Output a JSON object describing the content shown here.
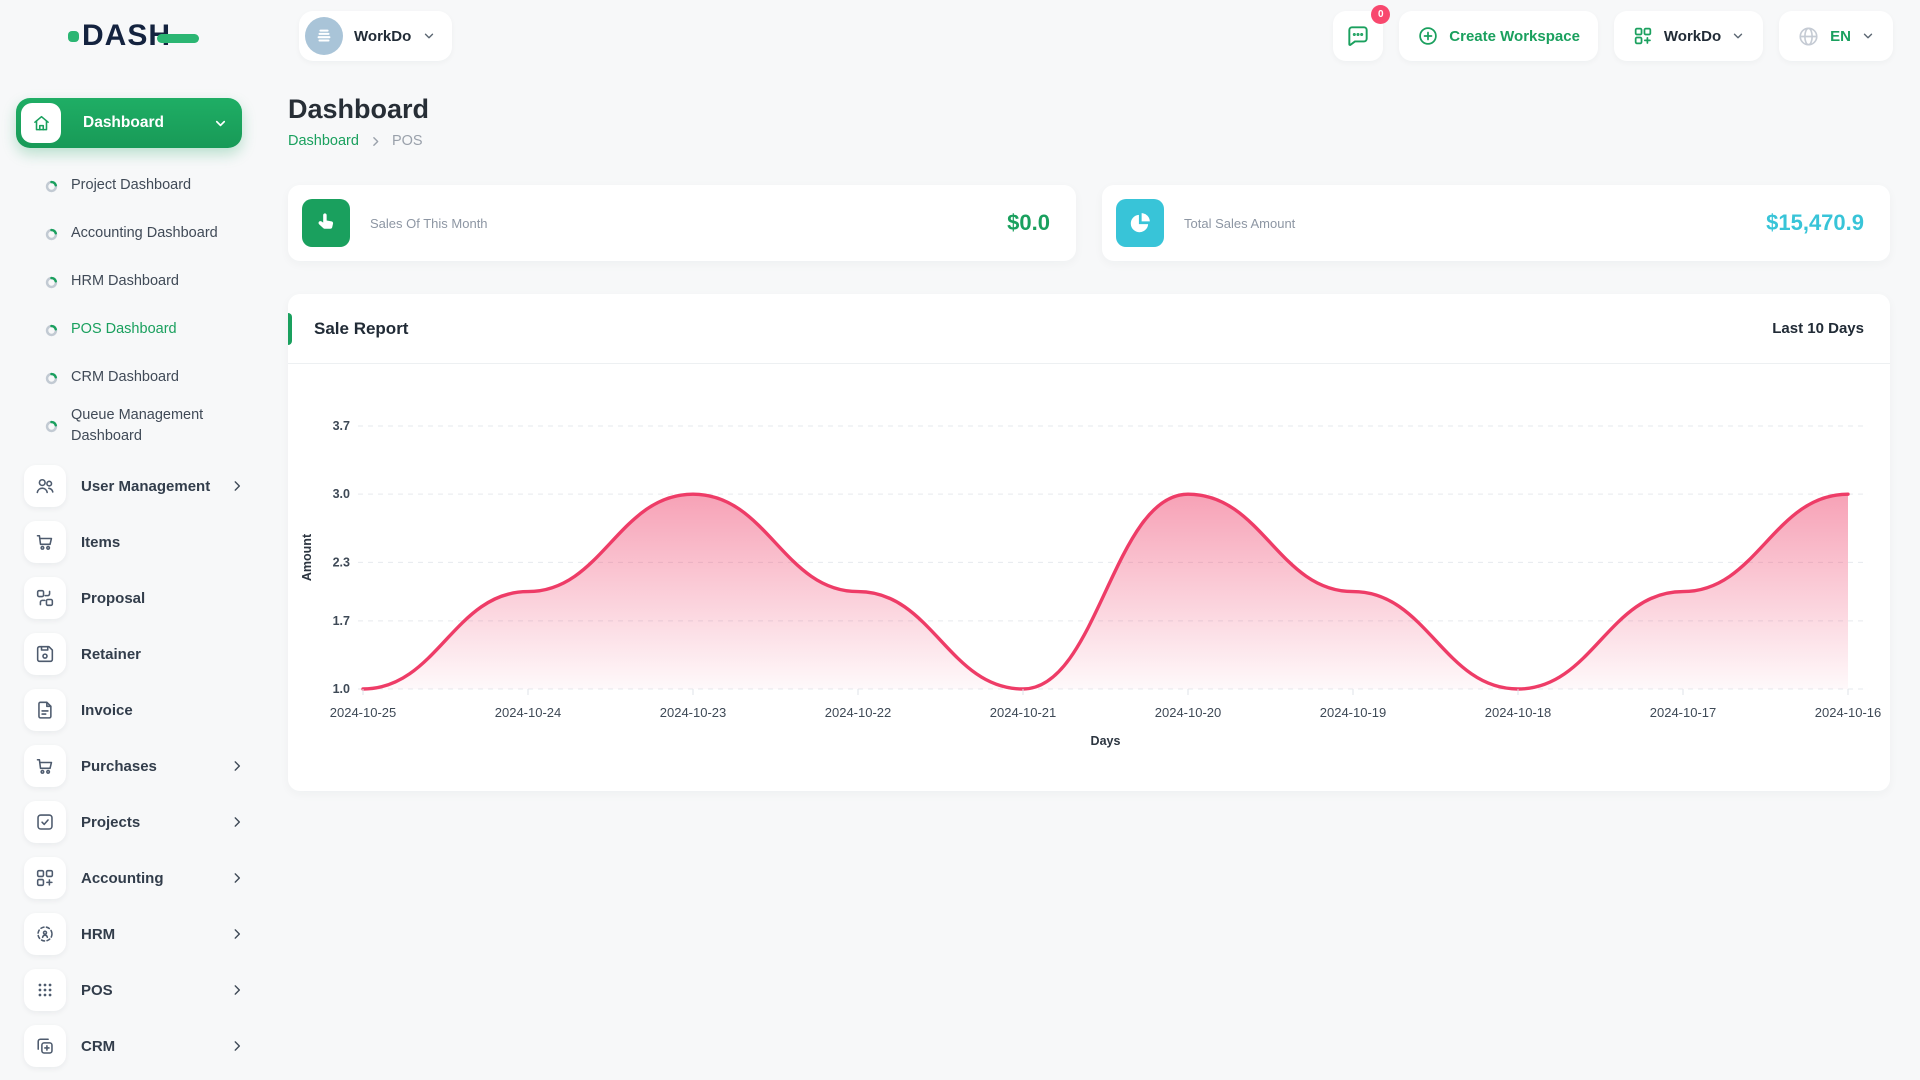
{
  "brand": {
    "logo_text": "DASH"
  },
  "header": {
    "workspace_name": "WorkDo",
    "messages_badge": "0",
    "create_workspace_label": "Create Workspace",
    "apps_menu_label": "WorkDo",
    "language_label": "EN"
  },
  "page": {
    "title": "Dashboard",
    "breadcrumb_root": "Dashboard",
    "breadcrumb_current": "POS"
  },
  "sidebar": {
    "active_label": "Dashboard",
    "dashboard_children": [
      "Project Dashboard",
      "Accounting Dashboard",
      "HRM Dashboard",
      "POS Dashboard",
      "CRM Dashboard",
      "Queue Management Dashboard"
    ],
    "active_child": "POS Dashboard",
    "items": [
      {
        "label": "User Management",
        "icon": "users-icon",
        "chevron": true
      },
      {
        "label": "Items",
        "icon": "cart-icon",
        "chevron": false
      },
      {
        "label": "Proposal",
        "icon": "route-squares-icon",
        "chevron": false
      },
      {
        "label": "Retainer",
        "icon": "save-icon",
        "chevron": false
      },
      {
        "label": "Invoice",
        "icon": "file-icon",
        "chevron": false
      },
      {
        "label": "Purchases",
        "icon": "cart-icon",
        "chevron": true
      },
      {
        "label": "Projects",
        "icon": "check-square-icon",
        "chevron": true
      },
      {
        "label": "Accounting",
        "icon": "grid-plus-icon",
        "chevron": true
      },
      {
        "label": "HRM",
        "icon": "focus-person-icon",
        "chevron": true
      },
      {
        "label": "POS",
        "icon": "dots-grid-icon",
        "chevron": true
      },
      {
        "label": "CRM",
        "icon": "copy-plus-icon",
        "chevron": true
      }
    ]
  },
  "cards": [
    {
      "label": "Sales Of This Month",
      "value": "$0.0",
      "icon": "tap-icon",
      "accent": "#1aa05e"
    },
    {
      "label": "Total Sales Amount",
      "value": "$15,470.9",
      "icon": "pie-chart-icon",
      "accent": "#38c4d8"
    }
  ],
  "chart_card": {
    "title": "Sale Report",
    "range_label": "Last 10 Days"
  },
  "chart_data": {
    "type": "area",
    "x": [
      "2024-10-25",
      "2024-10-24",
      "2024-10-23",
      "2024-10-22",
      "2024-10-21",
      "2024-10-20",
      "2024-10-19",
      "2024-10-18",
      "2024-10-17",
      "2024-10-16"
    ],
    "series": [
      {
        "name": "Amount",
        "values": [
          1.0,
          2.0,
          3.0,
          2.0,
          1.0,
          3.0,
          2.0,
          1.0,
          2.0,
          3.0
        ]
      }
    ],
    "title": "Sale Report",
    "xlabel": "Days",
    "ylabel": "Amount",
    "ylim": [
      1.0,
      3.7
    ],
    "yticks": [
      1.0,
      1.7,
      2.3,
      3.0,
      3.7
    ],
    "grid": "dashed-horizontal",
    "legend": "none",
    "line_color": "#ee3c67",
    "fill_from": "rgba(238,60,103,0.48)",
    "fill_to": "rgba(238,60,103,0.03)"
  },
  "colors": {
    "accent_green": "#1aa05e",
    "accent_cyan": "#38c4d8",
    "badge_pink": "#f8486e",
    "logo_green": "#2bb673",
    "text_dark": "#212b36",
    "text_muted": "#8d96a3"
  }
}
